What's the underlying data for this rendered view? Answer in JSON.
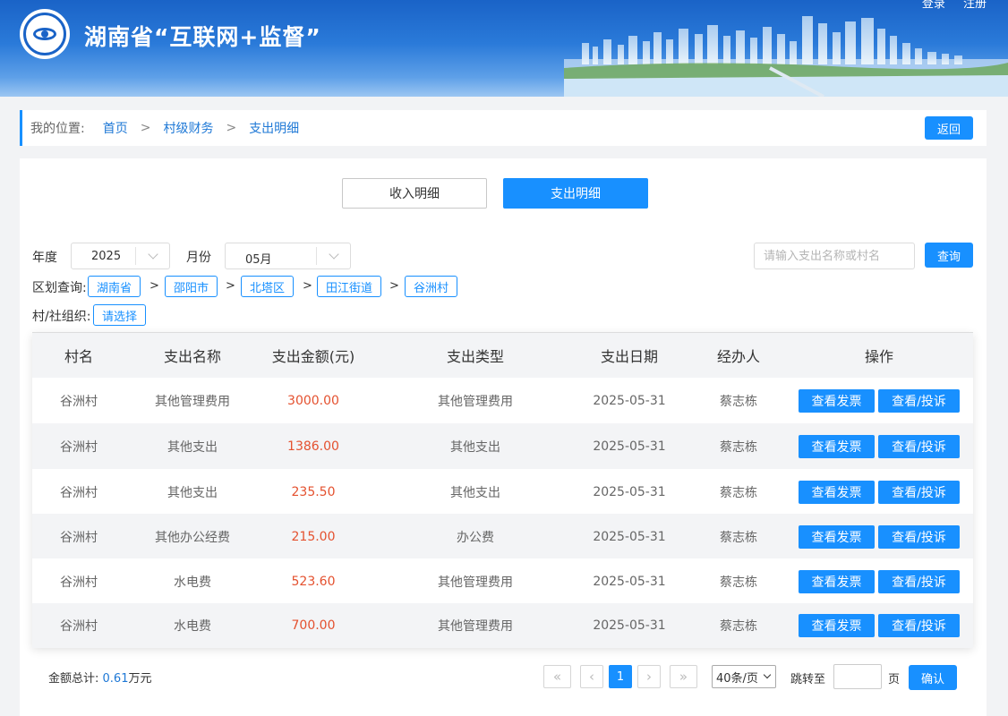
{
  "header": {
    "title": "湖南省“互联网+监督”",
    "links": [
      "登录",
      "注册"
    ]
  },
  "breadcrumb": {
    "label": "我的位置:",
    "items": [
      "首页",
      "村级财务",
      "支出明细"
    ],
    "separator": ">",
    "back": "返回"
  },
  "tabs": [
    "收入明细",
    "支出明细"
  ],
  "filters": {
    "year_label": "年度",
    "year_value": "2025",
    "month_label": "月份",
    "month_value": "05月",
    "search_placeholder": "请输入支出名称或村名",
    "query_button": "查询",
    "region_label": "区划查询:",
    "region_path": [
      "湖南省",
      "邵阳市",
      "北塔区",
      "田江街道",
      "谷洲村"
    ],
    "org_label": "村/社组织:",
    "org_value": "请选择"
  },
  "table": {
    "columns": [
      "村名",
      "支出名称",
      "支出金额(元)",
      "支出类型",
      "支出日期",
      "经办人",
      "操作"
    ],
    "rows": [
      {
        "village": "谷洲村",
        "name": "其他管理费用",
        "amount": "3000.00",
        "type": "其他管理费用",
        "date": "2025-05-31",
        "handler": "蔡志栋"
      },
      {
        "village": "谷洲村",
        "name": "其他支出",
        "amount": "1386.00",
        "type": "其他支出",
        "date": "2025-05-31",
        "handler": "蔡志栋"
      },
      {
        "village": "谷洲村",
        "name": "其他支出",
        "amount": "235.50",
        "type": "其他支出",
        "date": "2025-05-31",
        "handler": "蔡志栋"
      },
      {
        "village": "谷洲村",
        "name": "其他办公经费",
        "amount": "215.00",
        "type": "办公费",
        "date": "2025-05-31",
        "handler": "蔡志栋"
      },
      {
        "village": "谷洲村",
        "name": "水电费",
        "amount": "523.60",
        "type": "其他管理费用",
        "date": "2025-05-31",
        "handler": "蔡志栋"
      },
      {
        "village": "谷洲村",
        "name": "水电费",
        "amount": "700.00",
        "type": "其他管理费用",
        "date": "2025-05-31",
        "handler": "蔡志栋"
      }
    ],
    "action_invoice": "查看发票",
    "action_complaint": "查看/投诉"
  },
  "footer": {
    "total_label": "金额总计:",
    "total_value": "0.61",
    "total_unit": "万元",
    "pager": {
      "first": "«",
      "prev": "‹",
      "current": "1",
      "next": "›",
      "last": "»",
      "page_size": "40条/页",
      "jump_label": "跳转至",
      "page_unit": "页",
      "confirm": "确认"
    }
  },
  "colors": {
    "primary": "#1890ff",
    "amount": "#e4512f",
    "header_blue": "#1a63c7"
  }
}
